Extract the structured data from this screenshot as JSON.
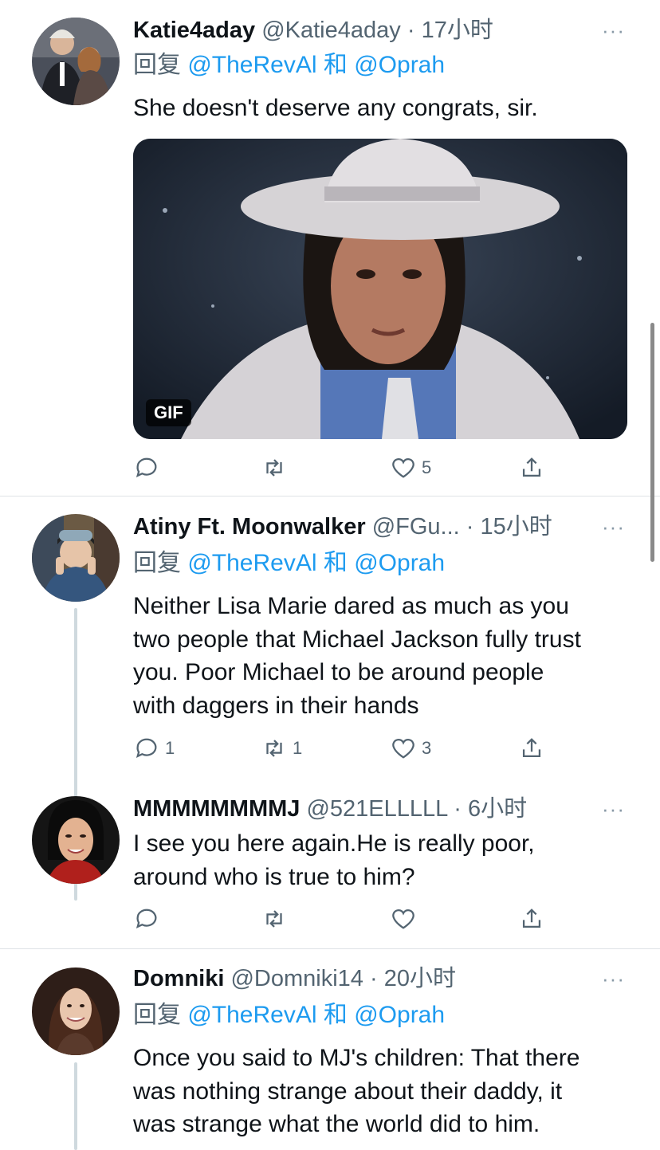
{
  "reply_prefix": "回复",
  "reply_joiner": "和",
  "tweets": [
    {
      "name": "Katie4aday",
      "handle": "@Katie4aday",
      "dot": "·",
      "time": "17小时",
      "reply_to": [
        "@TheRevAl",
        "@Oprah"
      ],
      "text": "She doesn't deserve any congrats, sir.",
      "media_badge": "GIF",
      "counts": {
        "reply": "",
        "retweet": "",
        "like": "5"
      }
    },
    {
      "name": "Atiny Ft. Moonwalker",
      "handle": "@FGu...",
      "dot": "·",
      "time": "15小时",
      "reply_to": [
        "@TheRevAl",
        "@Oprah"
      ],
      "text_lines": [
        "Neither Lisa Marie dared as much as you",
        "two people that Michael Jackson fully trust",
        "you.  Poor Michael to be around people",
        "with daggers in their hands"
      ],
      "counts": {
        "reply": "1",
        "retweet": "1",
        "like": "3"
      }
    },
    {
      "name": "MMMMMMMMJ",
      "handle": "@521ELLLLL",
      "dot": "·",
      "time": "6小时",
      "text_lines": [
        "I see you here again.He is really  poor,",
        "around who is true to him?"
      ],
      "counts": {
        "reply": "",
        "retweet": "",
        "like": ""
      }
    },
    {
      "name": "Domniki",
      "handle": "@Domniki14",
      "dot": "·",
      "time": "20小时",
      "reply_to": [
        "@TheRevAl",
        "@Oprah"
      ],
      "text_lines": [
        "Once you said to MJ's children: That there",
        "was nothing strange about their daddy, it",
        "was strange what the world did to him."
      ]
    }
  ],
  "more_glyph": "···",
  "colors": {
    "link": "#1d9bf0",
    "secondary": "#536471",
    "divider": "#dfe3e6"
  }
}
